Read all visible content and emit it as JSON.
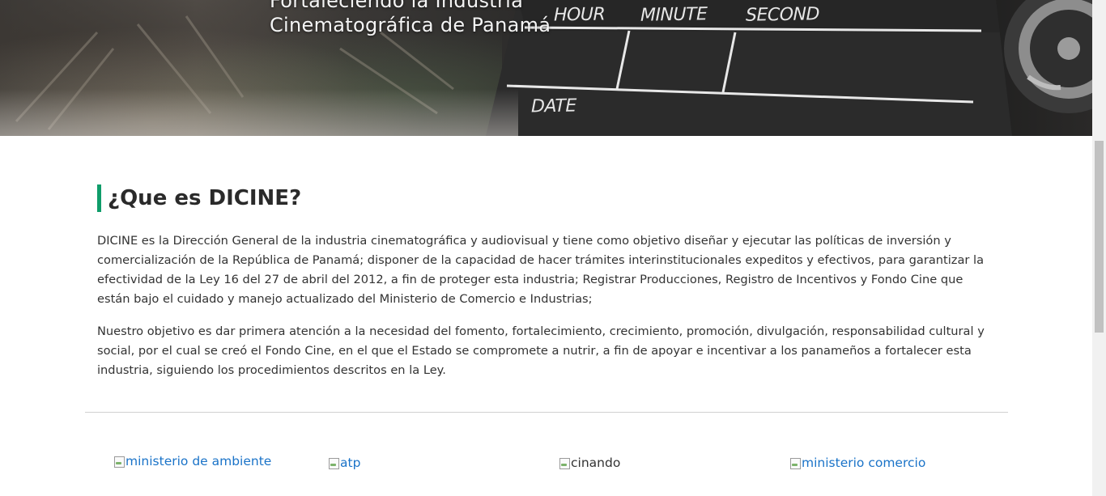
{
  "hero": {
    "title_line1": "Fortaleciendo la Industria",
    "title_line2": "Cinematográfica de Panamá",
    "clapper_labels": {
      "hour": "HOUR",
      "minute": "MINUTE",
      "second": "SECOND",
      "date": "DATE"
    }
  },
  "about": {
    "heading": "¿Que es DICINE?",
    "accent_color": "#0f9d6a",
    "paragraphs": [
      "DICINE es la Dirección General de la industria cinematográfica y audiovisual y  tiene como objetivo diseñar y ejecutar las políticas de inversión y comercialización de la República de Panamá; disponer de la capacidad de hacer trámites interinstitucionales expeditos y efectivos, para garantizar la efectividad de la Ley 16 del 27 de abril del 2012, a fin de proteger esta industria; Registrar Producciones, Registro de Incentivos y Fondo Cine que están bajo el cuidado y manejo actualizado del Ministerio de Comercio e Industrias;",
      "Nuestro objetivo es dar primera atención a la necesidad del fomento, fortalecimiento, crecimiento, promoción, divulgación, responsabilidad cultural y social, por el cual se creó el Fondo Cine, en el que el Estado se compromete a nutrir, a fin de apoyar e incentivar a los panameños a fortalecer esta industria, siguiendo los procedimientos descritos en la Ley."
    ]
  },
  "partners": [
    {
      "alt": "ministerio de ambiente",
      "is_link": true,
      "icon": "broken-image-icon"
    },
    {
      "alt": "atp",
      "is_link": true,
      "icon": "broken-image-icon"
    },
    {
      "alt": "cinando",
      "is_link": false,
      "icon": "broken-image-icon"
    },
    {
      "alt": "ministerio comercio",
      "is_link": true,
      "icon": "broken-image-icon"
    }
  ],
  "colors": {
    "link": "#1a73c8",
    "divider": "#d0d0d0"
  }
}
